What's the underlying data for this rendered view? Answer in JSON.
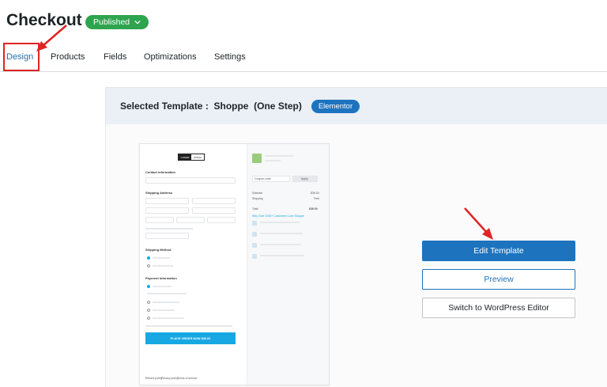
{
  "header": {
    "title": "Checkout",
    "status": "Published"
  },
  "tabs": [
    {
      "label": "Design",
      "active": true
    },
    {
      "label": "Products"
    },
    {
      "label": "Fields"
    },
    {
      "label": "Optimizations"
    },
    {
      "label": "Settings"
    }
  ],
  "template": {
    "selected_label": "Selected Template :  Shoppe  (One Step)",
    "builder_badge": "Elementor"
  },
  "preview": {
    "logo_left": "LOREM",
    "logo_right": "IPSUM",
    "contact_heading": "Contact information",
    "shipping_heading": "Shipping Address",
    "shipping_method_heading": "Shipping Method",
    "payment_heading": "Payment Information",
    "place_order": "PLACE ORDER NOW  $36.00",
    "subtotal_label": "Subtotal",
    "subtotal_value": "$36.00",
    "shipping_label": "Shipping",
    "shipping_value": "Free",
    "total_label": "Total",
    "total_value": "$36.00",
    "apply_label": "Apply",
    "coupon_placeholder": "Coupon code",
    "guarantee": "Why Over 2000+ Customers Love Shoppe",
    "footer_links": [
      "Refund policy",
      "Privacy policy",
      "Terms of service"
    ]
  },
  "actions": {
    "edit": "Edit Template",
    "preview": "Preview",
    "switch": "Switch to WordPress Editor"
  },
  "colors": {
    "primary": "#1e73be",
    "published": "#2ea44f",
    "highlight": "#e02424",
    "link_active": "#2271b1"
  }
}
